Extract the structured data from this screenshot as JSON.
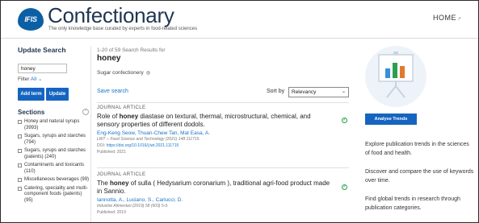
{
  "header": {
    "logo_text": "IFIS",
    "brand": "Confectionary",
    "tagline": "The only knowledge base curated by experts in food-related sciences",
    "home_link": "HOME"
  },
  "sidebar": {
    "title": "Update Search",
    "search_value": "honey",
    "filter_label": "Filter",
    "filter_value": "All",
    "add_term_label": "Add term",
    "update_label": "Update",
    "sections_title": "Sections",
    "sections": [
      {
        "label": "Honey and natural syrups (3993)"
      },
      {
        "label": "Sugars, syrups and starches (794)"
      },
      {
        "label": "Sugars, syrups and starches (patents) (240)"
      },
      {
        "label": "Contaminants and toxicants (110)"
      },
      {
        "label": "Miscellaneous beverages (99)"
      },
      {
        "label": "Catering, speciality and multi-component foods (patents) (95)"
      }
    ]
  },
  "main": {
    "result_count": "1-20 of 59 Search Results for",
    "query": "honey",
    "chip_label": "Sugar confectionery",
    "save_search": "Save search",
    "sort_label": "Sort by",
    "sort_value": "Relevancy",
    "articles": [
      {
        "type": "JOURNAL ARTICLE",
        "title_before": "Role of ",
        "title_highlight": "honey",
        "title_after": " diastase on textural, thermal, microstructural, chemical, and sensory properties of different dodols.",
        "authors": "Eng-Keng Seow, Thuan-Chew Tan, Mat Easa, A.",
        "journal": "LWT -- Food Science and Technology (2021) 148 111715.",
        "doi_label": "DOI:",
        "doi": "https://doi.org/10.1016/j.lwt.2021.111715",
        "published": "Published: 2021"
      },
      {
        "type": "JOURNAL ARTICLE",
        "title_before": "The ",
        "title_highlight": "honey",
        "title_after": " of sulla ( Hedysarium coronarium ), traditional agri-food product made in Sannio.",
        "authors": "Iannotta, A., Luciano, S., Carlucci, D.",
        "journal": "Industrie Alimentari (2019) 58 (603) 5-9.",
        "published": "Published: 2019"
      }
    ]
  },
  "right_panel": {
    "analyse_button": "Analyse Trends",
    "text_1": "Explore publication trends in the sciences of food and health.",
    "text_2": "Discover and compare the use of keywords over time.",
    "text_3": "Find global trends in research through publication categories."
  },
  "colors": {
    "brand_blue": "#1565c0",
    "link_blue": "#1a73c9",
    "title_navy": "#1f3550",
    "check_green": "#2e9e4f"
  }
}
